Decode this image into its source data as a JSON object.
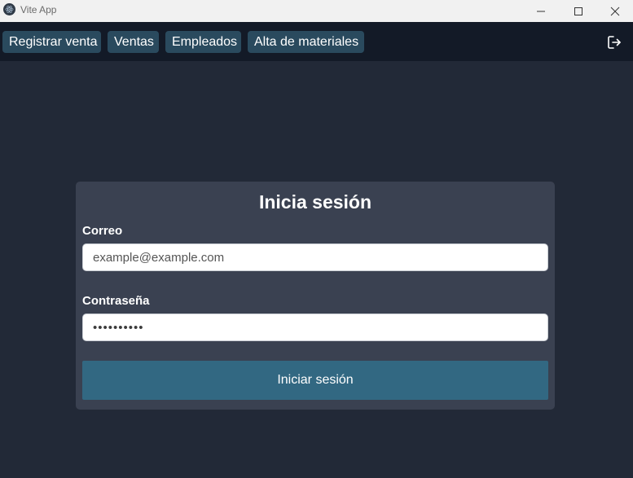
{
  "window": {
    "title": "Vite App",
    "icons": {
      "app": "electron-icon",
      "minimize": "minimize-icon",
      "maximize": "maximize-icon",
      "close": "close-icon"
    }
  },
  "nav": {
    "items": [
      {
        "label": "Registrar venta"
      },
      {
        "label": "Ventas"
      },
      {
        "label": "Empleados"
      },
      {
        "label": "Alta de materiales"
      }
    ],
    "logout_icon": "logout-icon"
  },
  "login": {
    "title": "Inicia sesión",
    "email_label": "Correo",
    "email_placeholder": "example@example.com",
    "email_value": "",
    "password_label": "Contraseña",
    "password_value": "••••••••••",
    "submit_label": "Iniciar sesión"
  },
  "colors": {
    "background": "#222937",
    "navbar": "#131a27",
    "nav_button": "#2a4a5e",
    "card": "#3a4151",
    "primary_button": "#326882"
  }
}
